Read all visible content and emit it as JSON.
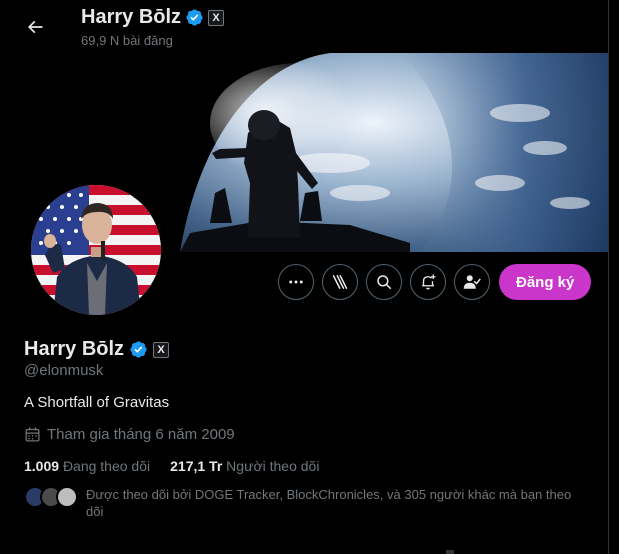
{
  "header": {
    "name": "Harry Bōlz",
    "post_count": "69,9 N bài đăng",
    "xbadge": "X"
  },
  "actions": {
    "more_icon": "more-dots-icon",
    "grok_icon": "grok-icon",
    "search_icon": "search-icon",
    "notify_icon": "bell-plus-icon",
    "follow_icon": "person-check-icon",
    "subscribe_label": "Đăng ký"
  },
  "profile": {
    "name": "Harry Bōlz",
    "xbadge": "X",
    "handle": "@elonmusk",
    "bio": "A Shortfall of Gravitas",
    "joined": "Tham gia tháng 6 năm 2009",
    "following_count": "1.009",
    "following_label": "Đang theo dõi",
    "followers_count": "217,1 Tr",
    "followers_label": "Người theo dõi",
    "followed_by": "Được theo dõi bởi DOGE Tracker, BlockChronicles, và 305 người khác mà bạn theo dõi"
  },
  "colors": {
    "accent": "#c936c9",
    "verified": "#1d9bf0",
    "muted": "#71767b",
    "text": "#e7e9ea"
  }
}
